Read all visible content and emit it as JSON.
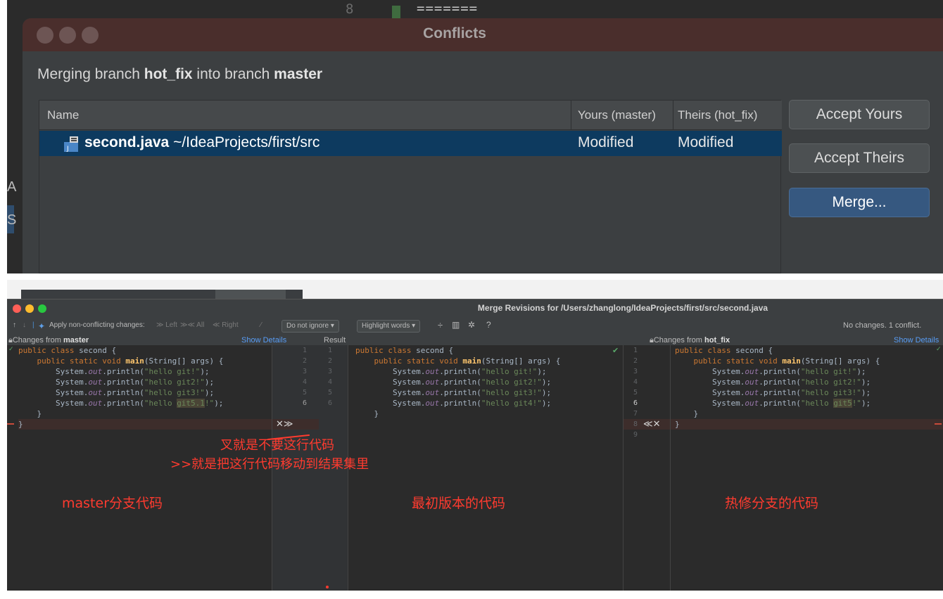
{
  "background": {
    "line_number": "8",
    "conflict_marker": "=======",
    "left_letter_a": "A",
    "left_letter_s": "S"
  },
  "dialog": {
    "title": "Conflicts",
    "subtitle_prefix": "Merging branch ",
    "source_branch": "hot_fix",
    "subtitle_middle": " into branch ",
    "target_branch": "master",
    "columns": {
      "name": "Name",
      "yours": "Yours (master)",
      "theirs": "Theirs (hot_fix)"
    },
    "row": {
      "file": "second.java",
      "path": " ~/IdeaProjects/first/src",
      "yours_status": "Modified",
      "theirs_status": "Modified"
    },
    "buttons": {
      "accept_yours": "Accept Yours",
      "accept_theirs": "Accept Theirs",
      "merge": "Merge..."
    }
  },
  "merge_window": {
    "title": "Merge Revisions for /Users/zhanglong/IdeaProjects/first/src/second.java",
    "toolbar": {
      "apply_label": "Apply non-conflicting changes:",
      "left": "Left",
      "all": "All",
      "right": "Right",
      "ignore_select": "Do not ignore",
      "highlight_select": "Highlight words",
      "help": "?",
      "status": "No changes. 1 conflict."
    },
    "headers": {
      "left_prefix": "Changes from ",
      "left_branch": "master",
      "show_details_left": "Show Details",
      "result": "Result",
      "right_prefix": "Changes from ",
      "right_branch": "hot_fix",
      "show_details_right": "Show Details"
    },
    "left_lines": [
      "public class second {",
      "    public static void main(String[] args) {",
      "        System.out.println(\"hello git!\");",
      "        System.out.println(\"hello git2!\");",
      "        System.out.println(\"hello git3!\");",
      "        System.out.println(\"hello git5.1!\");",
      "    }",
      "}"
    ],
    "center_lines": [
      "public class second {",
      "    public static void main(String[] args) {",
      "        System.out.println(\"hello git!\");",
      "        System.out.println(\"hello git2!\");",
      "        System.out.println(\"hello git3!\");",
      "        System.out.println(\"hello git4!\");",
      "    }"
    ],
    "right_lines": [
      "public class second {",
      "    public static void main(String[] args) {",
      "        System.out.println(\"hello git!\");",
      "        System.out.println(\"hello git2!\");",
      "        System.out.println(\"hello git3!\");",
      "        System.out.println(\"hello git5!\");",
      "    }",
      "}"
    ],
    "gutter_left_numbers": [
      "1",
      "2",
      "3",
      "4",
      "5",
      "6"
    ],
    "gutter_result_numbers": [
      "1",
      "2",
      "3",
      "4",
      "5",
      "6"
    ],
    "gutter_right_numbers": [
      "1",
      "2",
      "3",
      "4",
      "5",
      "6",
      "7",
      "8",
      "9"
    ],
    "conflict_left_controls": "✕≫",
    "conflict_right_controls": "≪✕"
  },
  "annotations": {
    "x_meaning": "叉就是不要这行代码",
    "arrow_meaning": ">>就是把这行代码移动到结果集里",
    "left_label": "master分支代码",
    "center_label": "最初版本的代码",
    "right_label": "热修分支的代码"
  },
  "colors": {
    "annotation": "#ff3b2f",
    "selected_row": "#0d3a5f",
    "merge_button": "#365880",
    "close_red": "#ff5f57",
    "minimize_yellow": "#febc2e",
    "zoom_green": "#28c840"
  }
}
